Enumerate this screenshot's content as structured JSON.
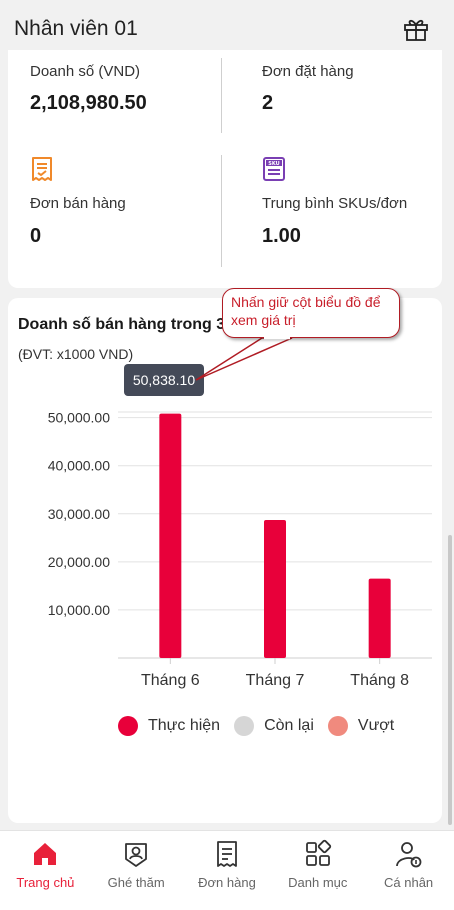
{
  "header": {
    "title": "Nhân viên 01",
    "gift_icon": "gift-icon"
  },
  "stats": {
    "sales_label": "Doanh số (VND)",
    "sales_value": "2,108,980.50",
    "orders_label": "Đơn đặt hàng",
    "orders_value": "2",
    "sold_orders_label": "Đơn bán hàng",
    "sold_orders_value": "0",
    "avg_sku_label": "Trung bình SKUs/đơn",
    "avg_sku_value": "1.00",
    "sku_icon_text": "SKU",
    "colors": {
      "orange": "#f0892a",
      "purple": "#7a3fb3"
    }
  },
  "chart": {
    "title": "Doanh số bán hàng trong 3",
    "unit": "(ĐVT: x1000 VND)",
    "tooltip": "50,838.10",
    "legend": [
      {
        "label": "Thực hiện",
        "color": "#e8003a"
      },
      {
        "label": "Còn lại",
        "color": "#d6d6d6"
      },
      {
        "label": "Vượt",
        "color": "#f08a7e"
      }
    ]
  },
  "callout": {
    "text": "Nhấn giữ cột biểu đồ để xem giá trị"
  },
  "chart_data": {
    "type": "bar",
    "categories": [
      "Tháng 6",
      "Tháng 7",
      "Tháng 8"
    ],
    "series": [
      {
        "name": "Thực hiện",
        "values": [
          50838.1,
          28700,
          16500
        ],
        "color": "#e8003a"
      }
    ],
    "yticks": [
      "10,000.00",
      "20,000.00",
      "30,000.00",
      "40,000.00",
      "50,000.00"
    ],
    "ylim": [
      0,
      52000
    ],
    "grid": true
  },
  "nav": {
    "items": [
      {
        "label": "Trang chủ",
        "icon": "home-icon"
      },
      {
        "label": "Ghé thăm",
        "icon": "visit-icon"
      },
      {
        "label": "Đơn hàng",
        "icon": "receipt-icon"
      },
      {
        "label": "Danh mục",
        "icon": "category-icon"
      },
      {
        "label": "Cá nhân",
        "icon": "profile-icon"
      }
    ],
    "active_color": "#e8213a"
  }
}
